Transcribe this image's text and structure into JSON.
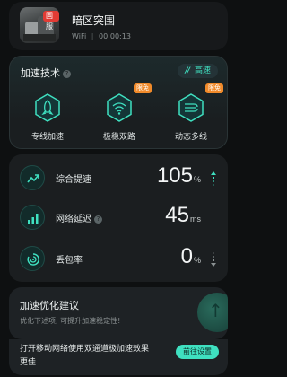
{
  "header": {
    "game_badge": "国服",
    "game_title": "暗区突围",
    "network": "WiFi",
    "separator": "|",
    "elapsed": "00:00:13"
  },
  "tech": {
    "title": "加速技术",
    "mode_icon_text": "//",
    "mode_label": "高速",
    "features": [
      {
        "label": "专线加速",
        "icon": "rocket-icon",
        "badge": ""
      },
      {
        "label": "极稳双路",
        "icon": "dual-wifi-icon",
        "badge": "限免"
      },
      {
        "label": "动态多线",
        "icon": "multi-line-icon",
        "badge": "限免"
      }
    ]
  },
  "stats": [
    {
      "label": "综合提速",
      "value": "105",
      "unit": "%",
      "icon": "trend-up-icon"
    },
    {
      "label": "网络延迟",
      "value": "45",
      "unit": "ms",
      "icon": "signal-bars-icon"
    },
    {
      "label": "丢包率",
      "value": "0",
      "unit": "%",
      "icon": "packet-loss-icon"
    }
  ],
  "optimize": {
    "title": "加速优化建议",
    "desc": "优化下述项, 可提升加速稳定性!"
  },
  "bottom": {
    "text": "打开移动网络使用双通道极加速效果更佳",
    "button": "前往设置"
  },
  "colors": {
    "accent": "#3fe0c0",
    "badge_red": "#e23b34",
    "badge_orange": "#f08a2a"
  }
}
